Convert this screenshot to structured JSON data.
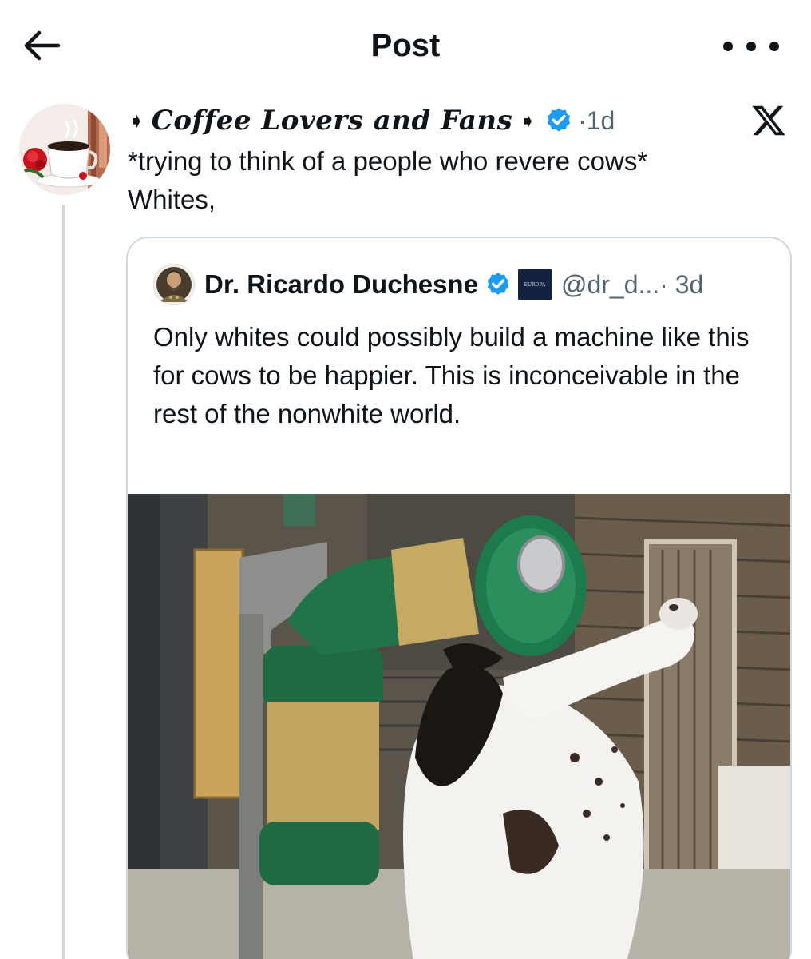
{
  "header": {
    "title": "Post",
    "back_icon": "arrow-left-icon",
    "more_icon": "more-horizontal-icon"
  },
  "post": {
    "display_name": "Coffee Lovers and Fans",
    "time_sep": " · ",
    "time": "1d",
    "text_line1": "*trying to think of a people who revere cows*",
    "text_line2": "Whites,",
    "source_icon": "x-logo-icon"
  },
  "quote": {
    "name": "Dr. Ricardo Duchesne",
    "badge_text": "EUROPA",
    "handle": "@dr_d...",
    "time": " · 3d",
    "text": "Only whites could possibly build a machine like this for cows to be happier. This is inconceivable in the rest of the nonwhite world."
  },
  "colors": {
    "verified_blue": "#1d9bf0",
    "secondary_text": "#536471",
    "border": "#cfd9de"
  }
}
